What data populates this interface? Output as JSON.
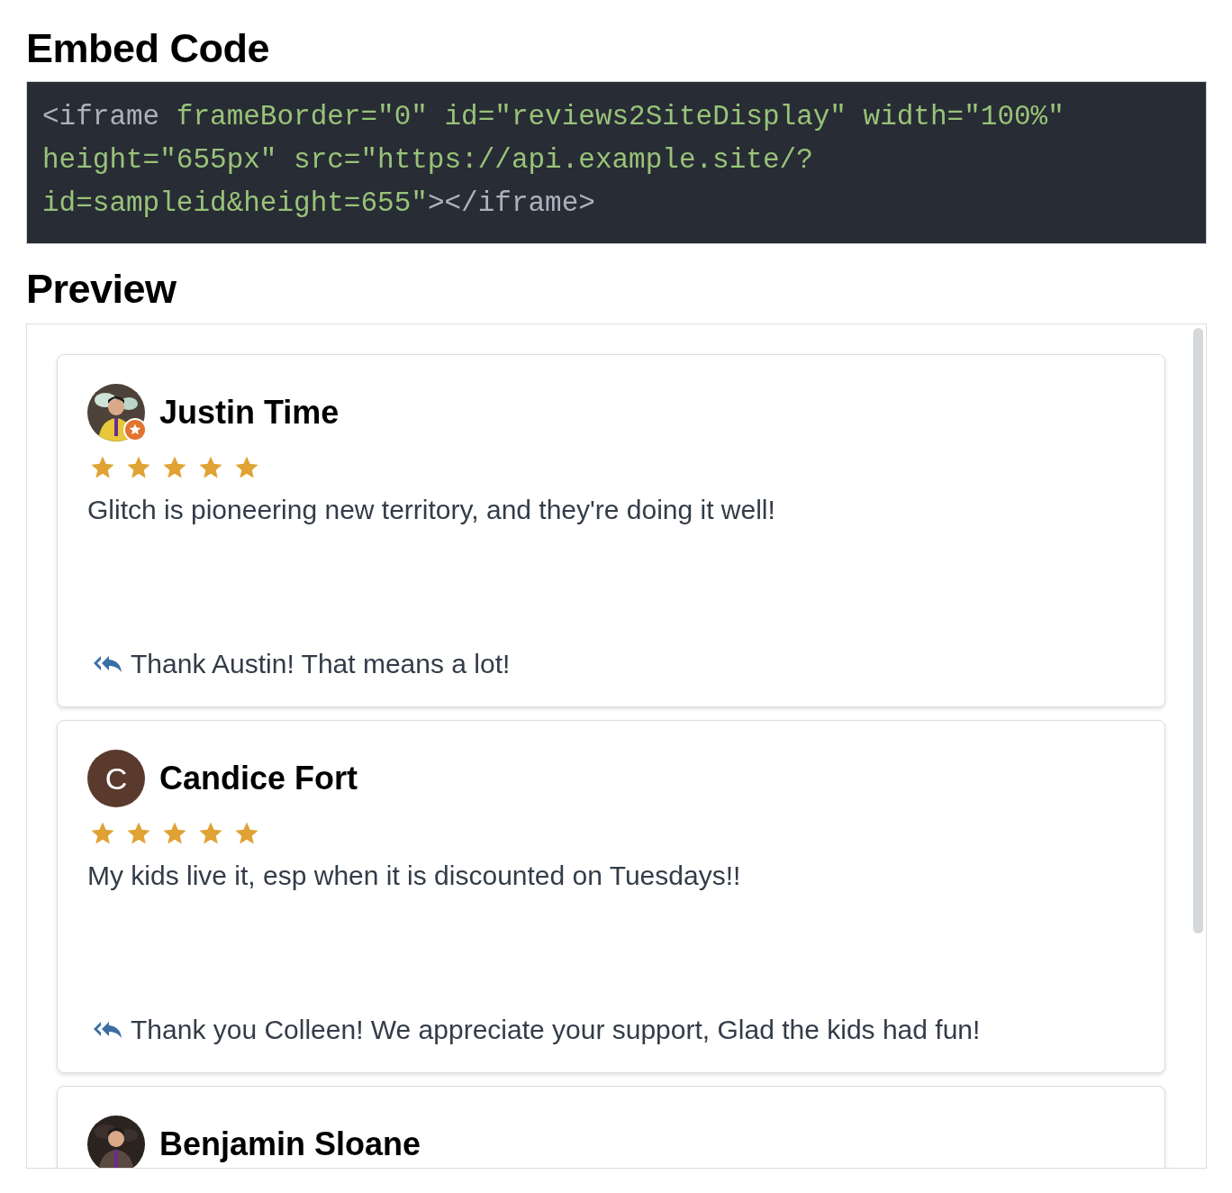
{
  "embed_heading": "Embed Code",
  "code_lines": [
    [
      {
        "kind": "tag",
        "text": "<iframe "
      },
      {
        "kind": "attr",
        "text": "frameBorder=\"0\" id=\"reviews2SiteDisplay\" width=\"100%\""
      }
    ],
    [
      {
        "kind": "attr",
        "text": "height=\"655px\" src=\"https://api.example.site/?"
      }
    ],
    [
      {
        "kind": "attr",
        "text": "id=sampleid&height=655\""
      },
      {
        "kind": "tag",
        "text": "></iframe>"
      }
    ]
  ],
  "preview_heading": "Preview",
  "reviews": [
    {
      "name": "Justin Time",
      "avatar": {
        "kind": "picture",
        "badge": true
      },
      "stars": 5,
      "text": "Glitch is pioneering new territory, and they're doing it well!",
      "reply": "Thank Austin! That means a lot!"
    },
    {
      "name": "Candice Fort",
      "avatar": {
        "kind": "letter",
        "letter": "C"
      },
      "stars": 5,
      "text": "My kids live it, esp when it is discounted on Tuesdays!!",
      "reply": "Thank you Colleen! We appreciate your support, Glad the kids had fun!"
    },
    {
      "name": "Benjamin Sloane",
      "avatar": {
        "kind": "picture"
      }
    }
  ]
}
